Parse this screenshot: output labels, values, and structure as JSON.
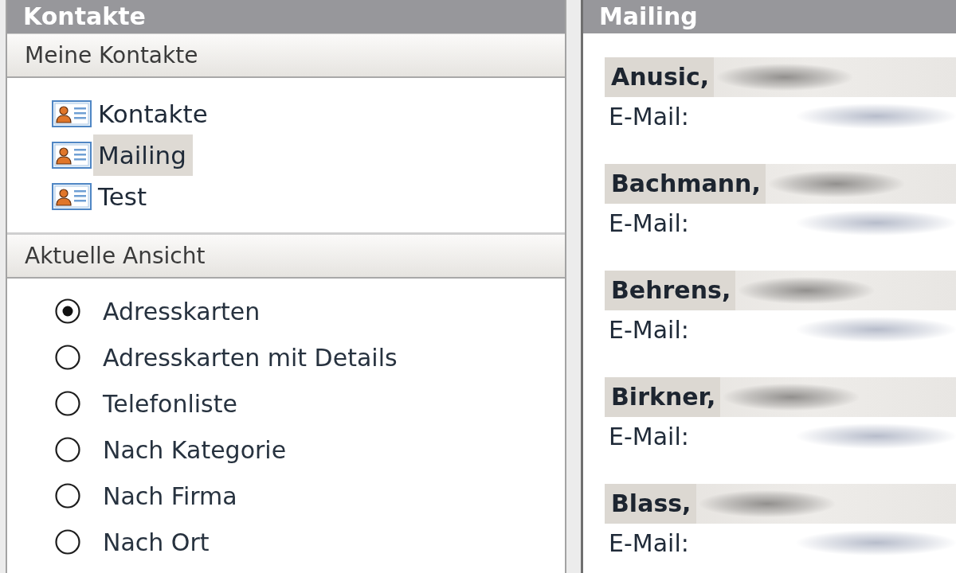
{
  "left_pane": {
    "title": "Kontakte",
    "sections": [
      {
        "title": "Meine Kontakte",
        "kind": "folders",
        "items": [
          {
            "label": "Kontakte",
            "selected": false
          },
          {
            "label": "Mailing",
            "selected": true
          },
          {
            "label": "Test",
            "selected": false
          }
        ]
      },
      {
        "title": "Aktuelle Ansicht",
        "kind": "views",
        "items": [
          {
            "label": "Adresskarten",
            "selected": true
          },
          {
            "label": "Adresskarten mit Details",
            "selected": false
          },
          {
            "label": "Telefonliste",
            "selected": false
          },
          {
            "label": "Nach Kategorie",
            "selected": false
          },
          {
            "label": "Nach Firma",
            "selected": false
          },
          {
            "label": "Nach Ort",
            "selected": false
          }
        ]
      }
    ]
  },
  "right_pane": {
    "title": "Mailing",
    "cards": [
      {
        "name": "Anusic,",
        "field_label": "E-Mail:"
      },
      {
        "name": "Bachmann,",
        "field_label": "E-Mail:"
      },
      {
        "name": "Behrens,",
        "field_label": "E-Mail:"
      },
      {
        "name": "Birkner,",
        "field_label": "E-Mail:"
      },
      {
        "name": "Blass,",
        "field_label": "E-Mail:"
      }
    ]
  }
}
